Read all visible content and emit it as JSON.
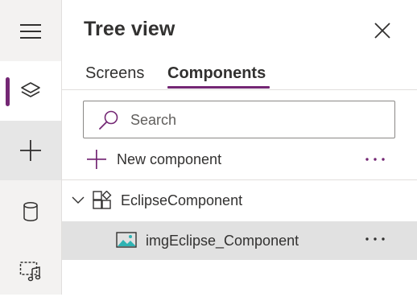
{
  "panel": {
    "title": "Tree view",
    "tabs": [
      {
        "label": "Screens",
        "active": false
      },
      {
        "label": "Components",
        "active": true
      }
    ],
    "search": {
      "placeholder": "Search",
      "value": ""
    },
    "new_component_label": "New component",
    "tree": [
      {
        "label": "EclipseComponent",
        "type": "component",
        "expanded": true
      },
      {
        "label": "imgEclipse_Component",
        "type": "image",
        "selected": true
      }
    ]
  },
  "rail": {
    "items": [
      "hamburger-icon",
      "layers-icon",
      "plus-icon",
      "data-icon",
      "media-icon"
    ],
    "active": "layers-icon"
  },
  "colors": {
    "accent": "#742774",
    "selected_row": "#e1e1e1",
    "rail": "#f3f2f1"
  }
}
